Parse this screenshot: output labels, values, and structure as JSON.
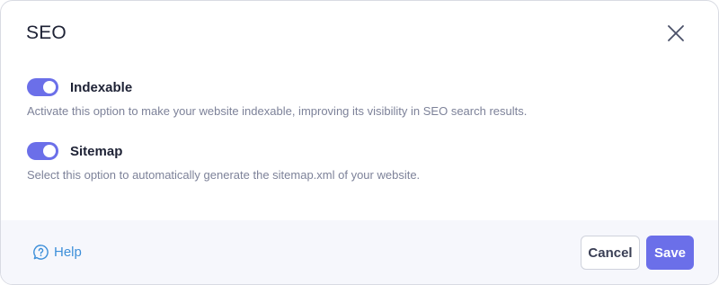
{
  "dialog": {
    "title": "SEO"
  },
  "options": [
    {
      "label": "Indexable",
      "enabled": true,
      "description": "Activate this option to make your website indexable, improving its visibility in SEO search results."
    },
    {
      "label": "Sitemap",
      "enabled": true,
      "description": "Select this option to automatically generate the sitemap.xml of your website."
    }
  ],
  "footer": {
    "help_label": "Help",
    "cancel_label": "Cancel",
    "save_label": "Save"
  },
  "colors": {
    "accent": "#6b6fe9",
    "link": "#3d8fd9",
    "footer_bg": "#f6f7fc"
  },
  "icons": {
    "close": "close-icon",
    "help": "help-icon"
  }
}
